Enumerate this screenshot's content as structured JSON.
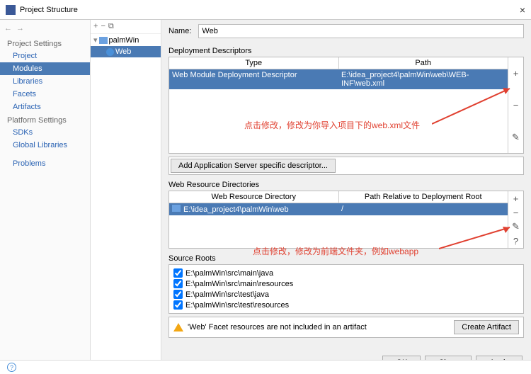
{
  "titlebar": {
    "title": "Project Structure"
  },
  "sidebar": {
    "sections": [
      {
        "title": "Project Settings",
        "items": [
          "Project",
          "Modules",
          "Libraries",
          "Facets",
          "Artifacts"
        ]
      },
      {
        "title": "Platform Settings",
        "items": [
          "SDKs",
          "Global Libraries"
        ]
      },
      {
        "title": "",
        "items": [
          "Problems"
        ]
      }
    ]
  },
  "tree": {
    "root": "palmWin",
    "child": "Web"
  },
  "name": {
    "label": "Name:",
    "value": "Web"
  },
  "deployment": {
    "label": "Deployment Descriptors",
    "cols": [
      "Type",
      "Path"
    ],
    "row": [
      "Web Module Deployment Descriptor",
      "E:\\idea_project4\\palmWin\\web\\WEB-INF\\web.xml"
    ],
    "add_btn": "Add Application Server specific descriptor..."
  },
  "resources": {
    "label": "Web Resource Directories",
    "cols": [
      "Web Resource Directory",
      "Path Relative to Deployment Root"
    ],
    "row": [
      "E:\\idea_project4\\palmWin\\web",
      "/"
    ]
  },
  "sourceRoots": {
    "label": "Source Roots",
    "items": [
      "E:\\palmWin\\src\\main\\java",
      "E:\\palmWin\\src\\main\\resources",
      "E:\\palmWin\\src\\test\\java",
      "E:\\palmWin\\src\\test\\resources"
    ]
  },
  "warning": {
    "text": "'Web' Facet resources are not included in an artifact",
    "btn": "Create Artifact"
  },
  "annotations": {
    "first": "点击修改，修改为你导入项目下的web.xml文件",
    "second": "点击修改，修改为前端文件夹，例如webapp"
  },
  "buttons": {
    "ok": "OK",
    "close": "Close",
    "apply": "Apply"
  }
}
